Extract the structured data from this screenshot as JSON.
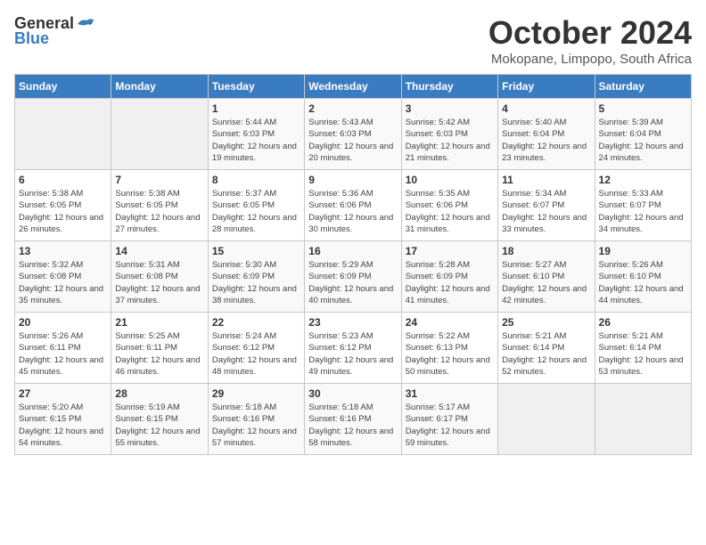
{
  "logo": {
    "general": "General",
    "blue": "Blue"
  },
  "header": {
    "title": "October 2024",
    "subtitle": "Mokopane, Limpopo, South Africa"
  },
  "weekdays": [
    "Sunday",
    "Monday",
    "Tuesday",
    "Wednesday",
    "Thursday",
    "Friday",
    "Saturday"
  ],
  "weeks": [
    [
      {
        "day": "",
        "sunrise": "",
        "sunset": "",
        "daylight": ""
      },
      {
        "day": "",
        "sunrise": "",
        "sunset": "",
        "daylight": ""
      },
      {
        "day": "1",
        "sunrise": "Sunrise: 5:44 AM",
        "sunset": "Sunset: 6:03 PM",
        "daylight": "Daylight: 12 hours and 19 minutes."
      },
      {
        "day": "2",
        "sunrise": "Sunrise: 5:43 AM",
        "sunset": "Sunset: 6:03 PM",
        "daylight": "Daylight: 12 hours and 20 minutes."
      },
      {
        "day": "3",
        "sunrise": "Sunrise: 5:42 AM",
        "sunset": "Sunset: 6:03 PM",
        "daylight": "Daylight: 12 hours and 21 minutes."
      },
      {
        "day": "4",
        "sunrise": "Sunrise: 5:40 AM",
        "sunset": "Sunset: 6:04 PM",
        "daylight": "Daylight: 12 hours and 23 minutes."
      },
      {
        "day": "5",
        "sunrise": "Sunrise: 5:39 AM",
        "sunset": "Sunset: 6:04 PM",
        "daylight": "Daylight: 12 hours and 24 minutes."
      }
    ],
    [
      {
        "day": "6",
        "sunrise": "Sunrise: 5:38 AM",
        "sunset": "Sunset: 6:05 PM",
        "daylight": "Daylight: 12 hours and 26 minutes."
      },
      {
        "day": "7",
        "sunrise": "Sunrise: 5:38 AM",
        "sunset": "Sunset: 6:05 PM",
        "daylight": "Daylight: 12 hours and 27 minutes."
      },
      {
        "day": "8",
        "sunrise": "Sunrise: 5:37 AM",
        "sunset": "Sunset: 6:05 PM",
        "daylight": "Daylight: 12 hours and 28 minutes."
      },
      {
        "day": "9",
        "sunrise": "Sunrise: 5:36 AM",
        "sunset": "Sunset: 6:06 PM",
        "daylight": "Daylight: 12 hours and 30 minutes."
      },
      {
        "day": "10",
        "sunrise": "Sunrise: 5:35 AM",
        "sunset": "Sunset: 6:06 PM",
        "daylight": "Daylight: 12 hours and 31 minutes."
      },
      {
        "day": "11",
        "sunrise": "Sunrise: 5:34 AM",
        "sunset": "Sunset: 6:07 PM",
        "daylight": "Daylight: 12 hours and 33 minutes."
      },
      {
        "day": "12",
        "sunrise": "Sunrise: 5:33 AM",
        "sunset": "Sunset: 6:07 PM",
        "daylight": "Daylight: 12 hours and 34 minutes."
      }
    ],
    [
      {
        "day": "13",
        "sunrise": "Sunrise: 5:32 AM",
        "sunset": "Sunset: 6:08 PM",
        "daylight": "Daylight: 12 hours and 35 minutes."
      },
      {
        "day": "14",
        "sunrise": "Sunrise: 5:31 AM",
        "sunset": "Sunset: 6:08 PM",
        "daylight": "Daylight: 12 hours and 37 minutes."
      },
      {
        "day": "15",
        "sunrise": "Sunrise: 5:30 AM",
        "sunset": "Sunset: 6:09 PM",
        "daylight": "Daylight: 12 hours and 38 minutes."
      },
      {
        "day": "16",
        "sunrise": "Sunrise: 5:29 AM",
        "sunset": "Sunset: 6:09 PM",
        "daylight": "Daylight: 12 hours and 40 minutes."
      },
      {
        "day": "17",
        "sunrise": "Sunrise: 5:28 AM",
        "sunset": "Sunset: 6:09 PM",
        "daylight": "Daylight: 12 hours and 41 minutes."
      },
      {
        "day": "18",
        "sunrise": "Sunrise: 5:27 AM",
        "sunset": "Sunset: 6:10 PM",
        "daylight": "Daylight: 12 hours and 42 minutes."
      },
      {
        "day": "19",
        "sunrise": "Sunrise: 5:26 AM",
        "sunset": "Sunset: 6:10 PM",
        "daylight": "Daylight: 12 hours and 44 minutes."
      }
    ],
    [
      {
        "day": "20",
        "sunrise": "Sunrise: 5:26 AM",
        "sunset": "Sunset: 6:11 PM",
        "daylight": "Daylight: 12 hours and 45 minutes."
      },
      {
        "day": "21",
        "sunrise": "Sunrise: 5:25 AM",
        "sunset": "Sunset: 6:11 PM",
        "daylight": "Daylight: 12 hours and 46 minutes."
      },
      {
        "day": "22",
        "sunrise": "Sunrise: 5:24 AM",
        "sunset": "Sunset: 6:12 PM",
        "daylight": "Daylight: 12 hours and 48 minutes."
      },
      {
        "day": "23",
        "sunrise": "Sunrise: 5:23 AM",
        "sunset": "Sunset: 6:12 PM",
        "daylight": "Daylight: 12 hours and 49 minutes."
      },
      {
        "day": "24",
        "sunrise": "Sunrise: 5:22 AM",
        "sunset": "Sunset: 6:13 PM",
        "daylight": "Daylight: 12 hours and 50 minutes."
      },
      {
        "day": "25",
        "sunrise": "Sunrise: 5:21 AM",
        "sunset": "Sunset: 6:14 PM",
        "daylight": "Daylight: 12 hours and 52 minutes."
      },
      {
        "day": "26",
        "sunrise": "Sunrise: 5:21 AM",
        "sunset": "Sunset: 6:14 PM",
        "daylight": "Daylight: 12 hours and 53 minutes."
      }
    ],
    [
      {
        "day": "27",
        "sunrise": "Sunrise: 5:20 AM",
        "sunset": "Sunset: 6:15 PM",
        "daylight": "Daylight: 12 hours and 54 minutes."
      },
      {
        "day": "28",
        "sunrise": "Sunrise: 5:19 AM",
        "sunset": "Sunset: 6:15 PM",
        "daylight": "Daylight: 12 hours and 55 minutes."
      },
      {
        "day": "29",
        "sunrise": "Sunrise: 5:18 AM",
        "sunset": "Sunset: 6:16 PM",
        "daylight": "Daylight: 12 hours and 57 minutes."
      },
      {
        "day": "30",
        "sunrise": "Sunrise: 5:18 AM",
        "sunset": "Sunset: 6:16 PM",
        "daylight": "Daylight: 12 hours and 58 minutes."
      },
      {
        "day": "31",
        "sunrise": "Sunrise: 5:17 AM",
        "sunset": "Sunset: 6:17 PM",
        "daylight": "Daylight: 12 hours and 59 minutes."
      },
      {
        "day": "",
        "sunrise": "",
        "sunset": "",
        "daylight": ""
      },
      {
        "day": "",
        "sunrise": "",
        "sunset": "",
        "daylight": ""
      }
    ]
  ]
}
